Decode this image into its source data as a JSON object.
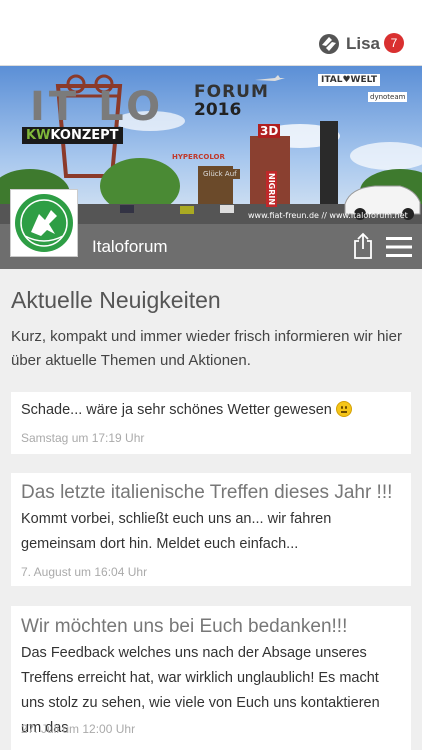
{
  "topbar": {
    "user_name": "Lisa",
    "notification_count": "7"
  },
  "banner": {
    "itlo": "IT  LO",
    "forum": "FORUM",
    "year": "2016",
    "kw_a": "KW",
    "kw_b": "KONZEPT",
    "italowelt": "ITAL♥WELT",
    "hypercolor": "HYPERCOLOR",
    "three_d": "3D",
    "nigrin": "NIGRIN",
    "gluck": "Glück Auf",
    "dyno": "dynoteam",
    "url": "www.fiat-freun.de // www.italoforum.net"
  },
  "header": {
    "title": "Italoforum"
  },
  "page": {
    "heading": "Aktuelle Neuigkeiten",
    "intro": "Kurz, kompakt und immer wieder frisch informieren wir hier über aktuelle Themen und Aktionen."
  },
  "posts": [
    {
      "title": "",
      "body": "Schade... wäre ja sehr schönes Wetter gewesen",
      "date": "Samstag um 17:19 Uhr"
    },
    {
      "title": "Das letzte italienische Treffen dieses Jahr !!!",
      "body": "Kommt vorbei, schließt euch uns an... wir fahren gemeinsam dort hin. Meldet euch einfach...",
      "date": "7. August um 16:04 Uhr"
    },
    {
      "title": "Wir möchten uns bei Euch bedanken!!!",
      "body": "Das Feedback welches uns nach der Absage unseres Treffens erreicht hat, war wirklich unglaublich! Es macht uns stolz zu sehen, wie viele von Euch uns kontaktieren um das",
      "date": "27. Juli um 12:00 Uhr"
    }
  ],
  "colors": {
    "header_bg": "#6e6e6e",
    "badge": "#d93030",
    "logo_green": "#2e9e45"
  }
}
